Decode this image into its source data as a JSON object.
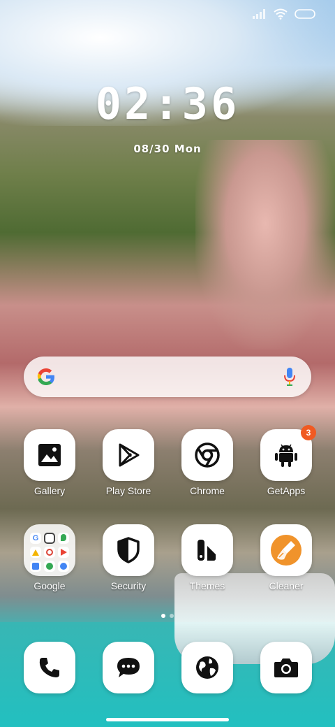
{
  "status_bar": {
    "icons": [
      "signal-icon",
      "wifi-icon",
      "battery-icon"
    ]
  },
  "clock": {
    "time": "02:36",
    "date": "08/30 Mon"
  },
  "search": {
    "logo": "google-logo",
    "mic": "mic-icon"
  },
  "home_apps": [
    {
      "label": "Gallery",
      "icon": "gallery-icon"
    },
    {
      "label": "Play Store",
      "icon": "play-store-icon"
    },
    {
      "label": "Chrome",
      "icon": "chrome-icon"
    },
    {
      "label": "GetApps",
      "icon": "android-icon",
      "badge": "3"
    },
    {
      "label": "Google",
      "icon": "folder-icon"
    },
    {
      "label": "Security",
      "icon": "shield-icon"
    },
    {
      "label": "Themes",
      "icon": "themes-icon"
    },
    {
      "label": "Cleaner",
      "icon": "brush-icon"
    }
  ],
  "page_indicator": {
    "count": 2,
    "active": 1
  },
  "dock": [
    {
      "icon": "phone-icon"
    },
    {
      "icon": "messages-icon"
    },
    {
      "icon": "browser-icon"
    },
    {
      "icon": "camera-icon"
    }
  ],
  "colors": {
    "badge": "#f05a22",
    "cleaner_accent": "#f0932b",
    "icon_dark": "#111111"
  }
}
